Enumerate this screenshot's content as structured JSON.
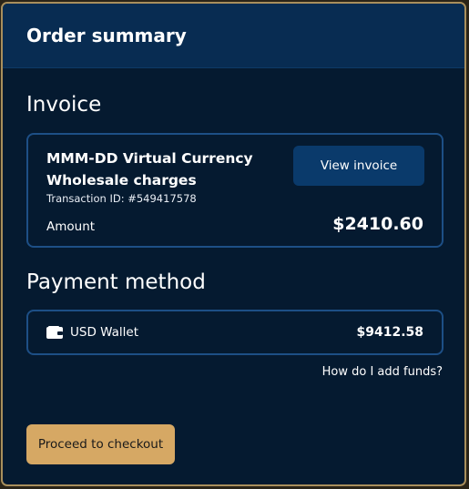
{
  "header": {
    "title": "Order summary"
  },
  "invoice": {
    "section_title": "Invoice",
    "name": "MMM-DD Virtual Currency Wholesale charges",
    "transaction_id": "Transaction ID: #549417578",
    "view_button_label": "View invoice",
    "amount_label": "Amount",
    "amount_value": "$2410.60"
  },
  "payment": {
    "section_title": "Payment method",
    "wallet_icon": "wallet-icon",
    "wallet_label": "USD Wallet",
    "wallet_balance": "$9412.58",
    "add_funds_link": "How do I add funds?"
  },
  "actions": {
    "checkout_label": "Proceed to checkout"
  },
  "colors": {
    "panel_bg": "#051a30",
    "header_bg": "#082c52",
    "card_border": "#1d4f86",
    "primary_button": "#0a3a6b",
    "checkout_button": "#d6a864",
    "panel_border": "#a98f5c"
  }
}
